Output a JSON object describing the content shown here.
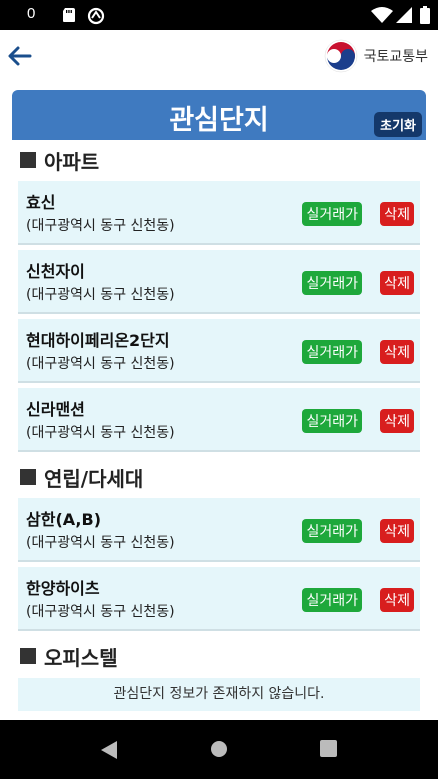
{
  "status_bar": {
    "clock": "0"
  },
  "header": {
    "brand_text": "국토교통부"
  },
  "page": {
    "title": "관심단지",
    "reset_label": "초기화"
  },
  "sections": [
    {
      "heading": "아파트",
      "items": [
        {
          "name": "효신",
          "address": "(대구광역시 동구 신천동)"
        },
        {
          "name": "신천자이",
          "address": "(대구광역시 동구 신천동)"
        },
        {
          "name": "현대하이페리온2단지",
          "address": "(대구광역시 동구 신천동)"
        },
        {
          "name": "신라맨션",
          "address": "(대구광역시 동구 신천동)"
        }
      ]
    },
    {
      "heading": "연립/다세대",
      "items": [
        {
          "name": "삼한(A,B)",
          "address": "(대구광역시 동구 신천동)"
        },
        {
          "name": "한양하이츠",
          "address": "(대구광역시 동구 신천동)"
        }
      ]
    },
    {
      "heading": "오피스텔",
      "empty_message": "관심단지 정보가 존재하지 않습니다."
    }
  ],
  "buttons": {
    "price_label": "실거래가",
    "delete_label": "삭제"
  },
  "colors": {
    "accent": "#3f7ac0",
    "reset": "#14386a",
    "price": "#1ea83b",
    "delete": "#d81e1e",
    "card_bg": "#e5f6fa"
  }
}
